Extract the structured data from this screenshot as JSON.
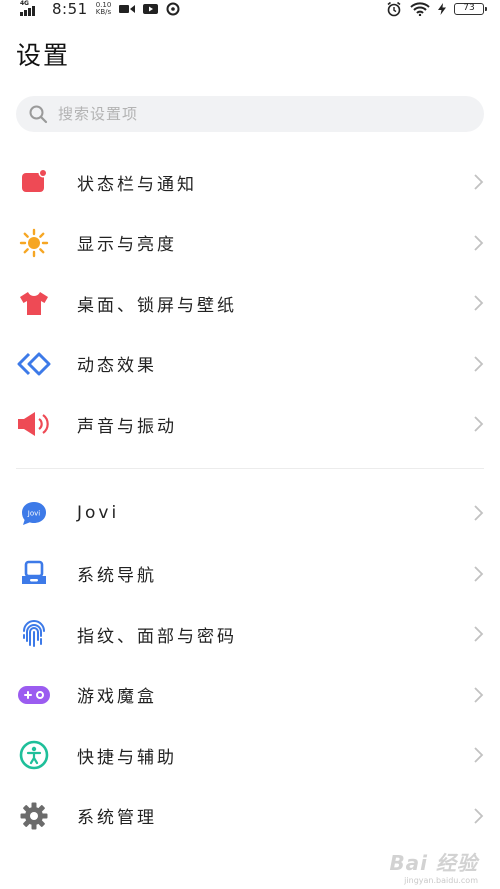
{
  "status_bar": {
    "network": "4G",
    "time": "8:51",
    "speed_value": "0.10",
    "speed_unit": "KB/s",
    "battery": "73"
  },
  "header": {
    "title": "设置"
  },
  "search": {
    "placeholder": "搜索设置项"
  },
  "sections": [
    {
      "items": [
        {
          "label": "状态栏与通知",
          "icon": "notification-icon",
          "color": "#ee4a55"
        },
        {
          "label": "显示与亮度",
          "icon": "sun-icon",
          "color": "#f6a623"
        },
        {
          "label": "桌面、锁屏与壁纸",
          "icon": "tshirt-icon",
          "color": "#ee4a55"
        },
        {
          "label": "动态效果",
          "icon": "diamond-icon",
          "color": "#3d7ae8"
        },
        {
          "label": "声音与振动",
          "icon": "speaker-icon",
          "color": "#ee4a55"
        }
      ]
    },
    {
      "items": [
        {
          "label": "Jovi",
          "icon": "jovi-icon",
          "color": "#3d7ae8",
          "badge": "Jovi"
        },
        {
          "label": "系统导航",
          "icon": "navigation-icon",
          "color": "#3d7ae8"
        },
        {
          "label": "指纹、面部与密码",
          "icon": "fingerprint-icon",
          "color": "#3d7ae8"
        },
        {
          "label": "游戏魔盒",
          "icon": "gamepad-icon",
          "color": "#9b5cf0"
        },
        {
          "label": "快捷与辅助",
          "icon": "accessibility-icon",
          "color": "#1fbf9a"
        },
        {
          "label": "系统管理",
          "icon": "gear-icon",
          "color": "#6b6b6b"
        }
      ]
    }
  ],
  "watermark": {
    "logo": "Bai 经验",
    "url": "jingyan.baidu.com"
  }
}
